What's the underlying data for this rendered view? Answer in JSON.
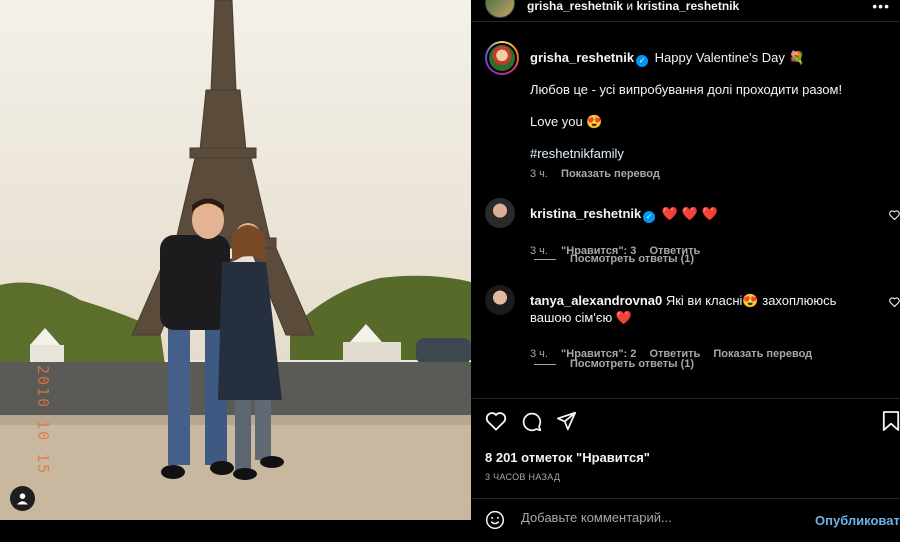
{
  "header": {
    "user1": "grisha_reshetnik",
    "conj": "и",
    "user2": "kristina_reshetnik",
    "more_icon": "more-horizontal-icon"
  },
  "photo": {
    "date_stamp": "2010 10 15",
    "tag_icon": "user-tag-icon"
  },
  "caption": {
    "username": "grisha_reshetnik",
    "title": "Happy Valentine's Day",
    "title_emoji": "💐",
    "line1": "Любов це - усі випробування долі проходити разом!",
    "line2": "Love you",
    "line2_emoji": "😍",
    "hashtag": "#reshetnikfamily",
    "time": "3 ч.",
    "translate": "Показать перевод"
  },
  "comments": [
    {
      "username": "kristina_reshetnik",
      "text": "❤️ ❤️ ❤️",
      "time": "3 ч.",
      "likes": "\"Нравится\": 3",
      "reply": "Ответить",
      "view_replies": "Посмотреть ответы (1)"
    },
    {
      "username": "tanya_alexandrovna0",
      "text": "Які ви класні😍 захоплююсь вашою сім'єю ❤️",
      "time": "3 ч.",
      "likes": "\"Нравится\": 2",
      "reply": "Ответить",
      "translate": "Показать перевод",
      "view_replies": "Посмотреть ответы (1)"
    }
  ],
  "actions": {
    "likes": "8 201 отметок \"Нравится\"",
    "time_ago": "3 ЧАСОВ НАЗАД"
  },
  "comment_bar": {
    "placeholder": "Добавьте комментарий...",
    "publish": "Опубликовать"
  },
  "colors": {
    "background": "#000000",
    "accent": "#0095f6",
    "publish": "#6fb1e4",
    "heart": "#ed1c3b"
  }
}
